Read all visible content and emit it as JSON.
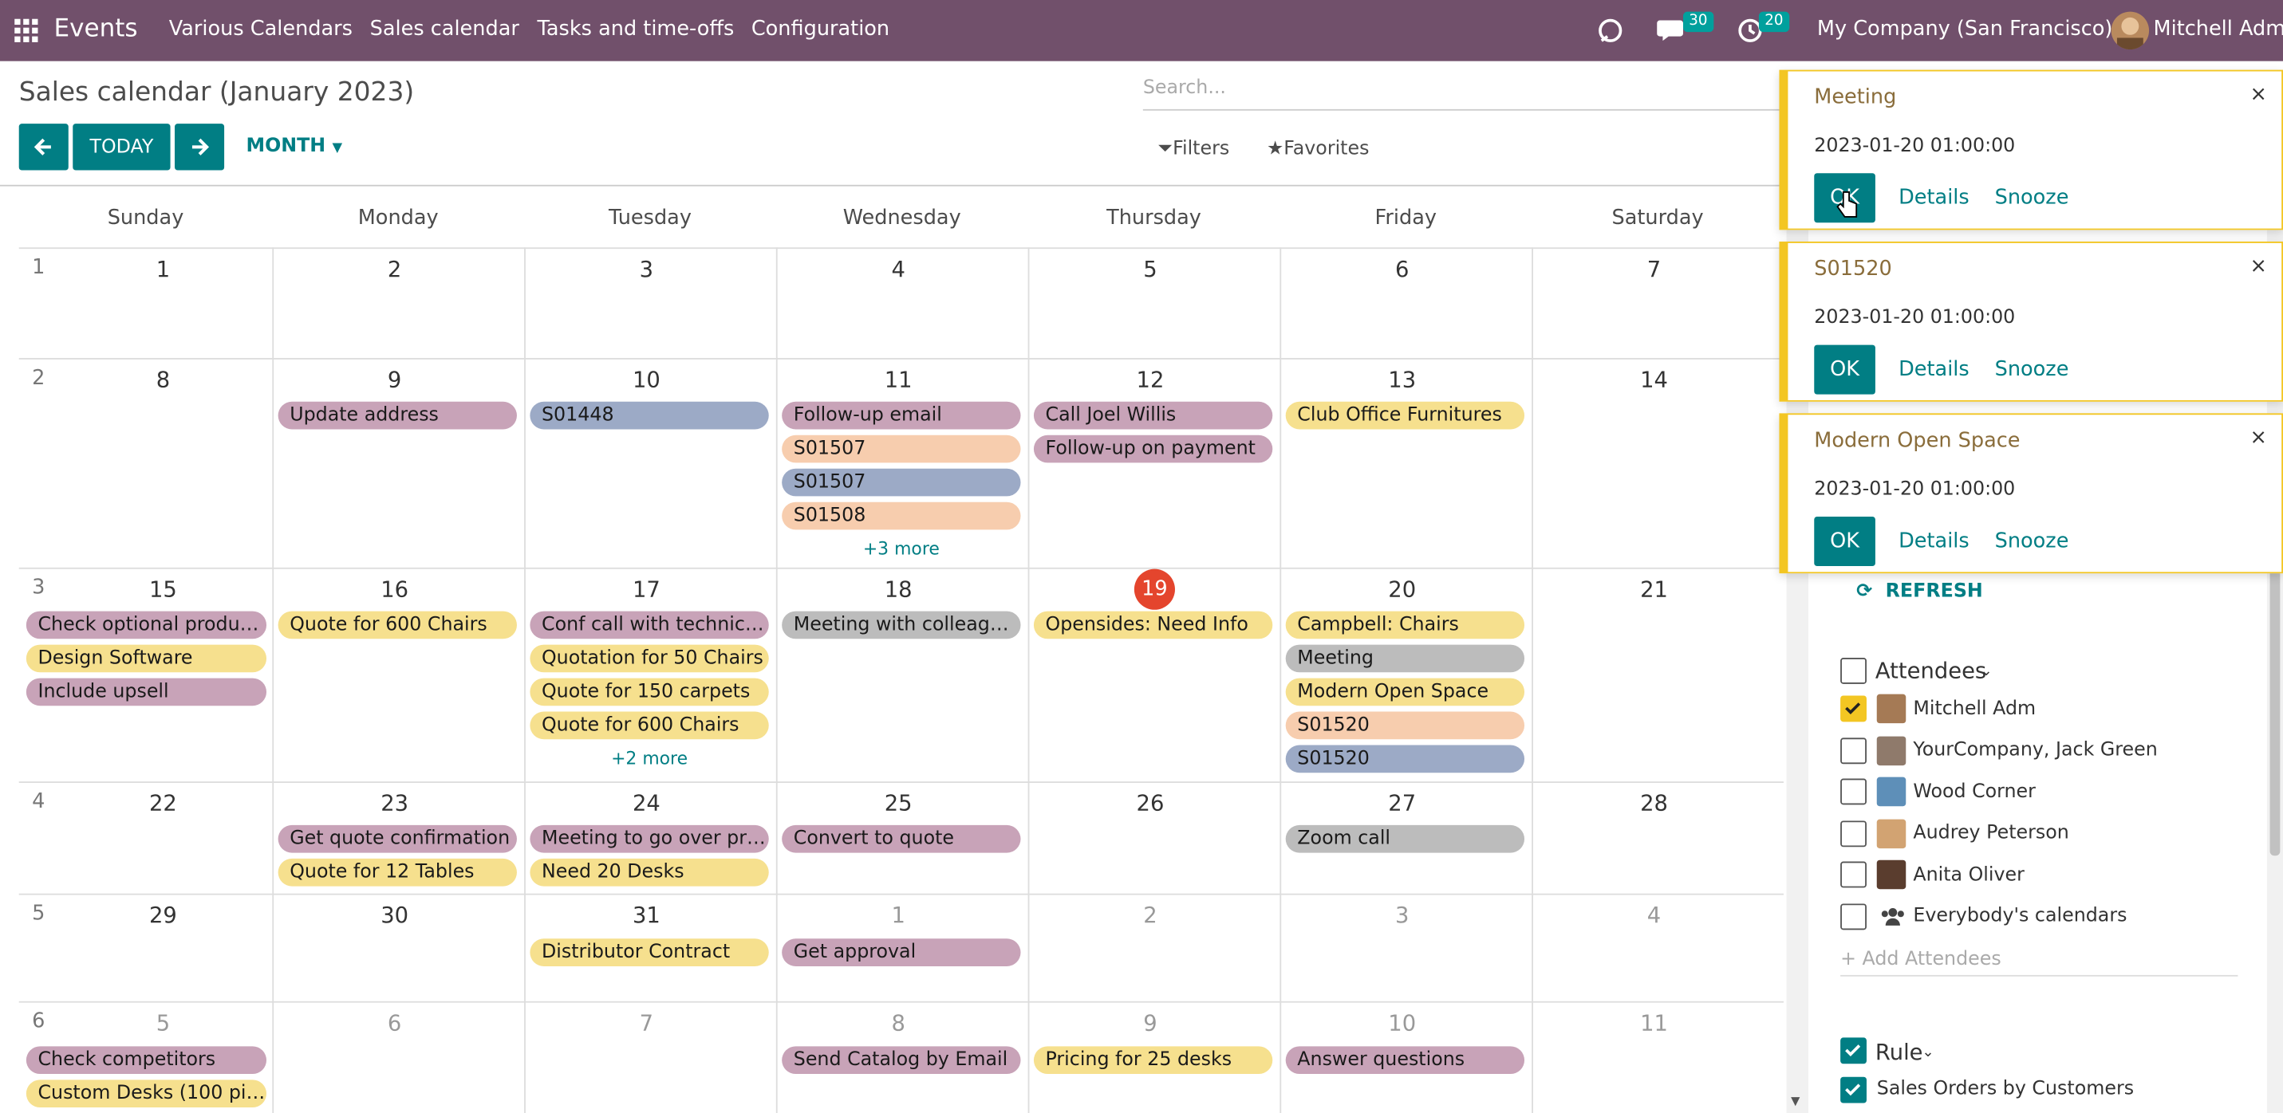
{
  "topbar": {
    "app_name": "Events",
    "menus": [
      "Various Calendars",
      "Sales calendar",
      "Tasks and time-offs",
      "Configuration"
    ],
    "chat_count": "30",
    "activity_count": "20",
    "company": "My Company (San Francisco)",
    "user": "Mitchell Adm"
  },
  "control_panel": {
    "title": "Sales calendar (January 2023)",
    "today_label": "TODAY",
    "scale_label": "MONTH",
    "search_placeholder": "Search...",
    "filters_label": "Filters",
    "favorites_label": "Favorites"
  },
  "calendar": {
    "days": [
      "Sunday",
      "Monday",
      "Tuesday",
      "Wednesday",
      "Thursday",
      "Friday",
      "Saturday"
    ],
    "weeks": [
      {
        "week": "1",
        "dates": [
          "1",
          "2",
          "3",
          "4",
          "5",
          "6",
          "7"
        ]
      },
      {
        "week": "2",
        "dates": [
          "8",
          "9",
          "10",
          "11",
          "12",
          "13",
          "14"
        ]
      },
      {
        "week": "3",
        "dates": [
          "15",
          "16",
          "17",
          "18",
          "19",
          "20",
          "21"
        ]
      },
      {
        "week": "4",
        "dates": [
          "22",
          "23",
          "24",
          "25",
          "26",
          "27",
          "28"
        ]
      },
      {
        "week": "5",
        "dates": [
          "29",
          "30",
          "31",
          "1",
          "2",
          "3",
          "4"
        ]
      },
      {
        "week": "6",
        "dates": [
          "5",
          "6",
          "7",
          "8",
          "9",
          "10",
          "11"
        ]
      }
    ],
    "events": {
      "w2": {
        "mon": [
          "Update address"
        ],
        "tue": [
          "S01448"
        ],
        "wed": [
          "Follow-up email",
          "S01507",
          "S01507",
          "S01508"
        ],
        "wed_more": "+3 more",
        "thu": [
          "Call Joel Willis",
          "Follow-up on payment"
        ],
        "fri": [
          "Club Office Furnitures"
        ]
      },
      "w3": {
        "sun": [
          "Check optional products",
          "Design Software",
          "Include upsell"
        ],
        "mon": [
          "Quote for 600 Chairs"
        ],
        "tue": [
          "Conf call with technical...",
          "Quotation for 50 Chairs",
          "Quote for 150 carpets",
          "Quote for 600 Chairs"
        ],
        "tue_more": "+2 more",
        "wed": [
          "Meeting with colleagues"
        ],
        "thu": [
          "Opensides: Need Info"
        ],
        "fri": [
          "Campbell: Chairs",
          "Meeting",
          "Modern Open Space",
          "S01520",
          "S01520"
        ]
      },
      "w4": {
        "mon": [
          "Get quote confirmation",
          "Quote for 12 Tables"
        ],
        "tue": [
          "Meeting to go over pri...",
          "Need 20 Desks"
        ],
        "wed": [
          "Convert to quote"
        ],
        "fri": [
          "Zoom call"
        ]
      },
      "w5": {
        "tue": [
          "Distributor Contract"
        ],
        "wed": [
          "Get approval"
        ]
      },
      "w6": {
        "sun": [
          "Check competitors",
          "Custom Desks (100 pie..."
        ],
        "wed": [
          "Send Catalog by Email"
        ],
        "thu": [
          "Pricing for 25 desks"
        ],
        "fri": [
          "Answer questions"
        ]
      }
    }
  },
  "sidebar": {
    "refresh_label": "REFRESH",
    "attendees_label": "Attendees",
    "attendees": [
      "Mitchell Adm",
      "YourCompany, Jack Green",
      "Wood Corner",
      "Audrey Peterson",
      "Anita Oliver",
      "Everybody's calendars"
    ],
    "add_attendees": "+ Add Attendees",
    "rule_label": "Rule",
    "rule_items": [
      "Sales Orders by Customers"
    ]
  },
  "notifications": [
    {
      "title": "Meeting",
      "time": "2023-01-20 01:00:00",
      "ok": "OK",
      "details": "Details",
      "snooze": "Snooze"
    },
    {
      "title": "S01520",
      "time": "2023-01-20 01:00:00",
      "ok": "OK",
      "details": "Details",
      "snooze": "Snooze"
    },
    {
      "title": "Modern Open Space",
      "time": "2023-01-20 01:00:00",
      "ok": "OK",
      "details": "Details",
      "snooze": "Snooze"
    }
  ],
  "colors": {
    "topbar": "#71506b",
    "primary": "#017e84",
    "today": "#e4452d",
    "notification_border": "#f3c623"
  }
}
